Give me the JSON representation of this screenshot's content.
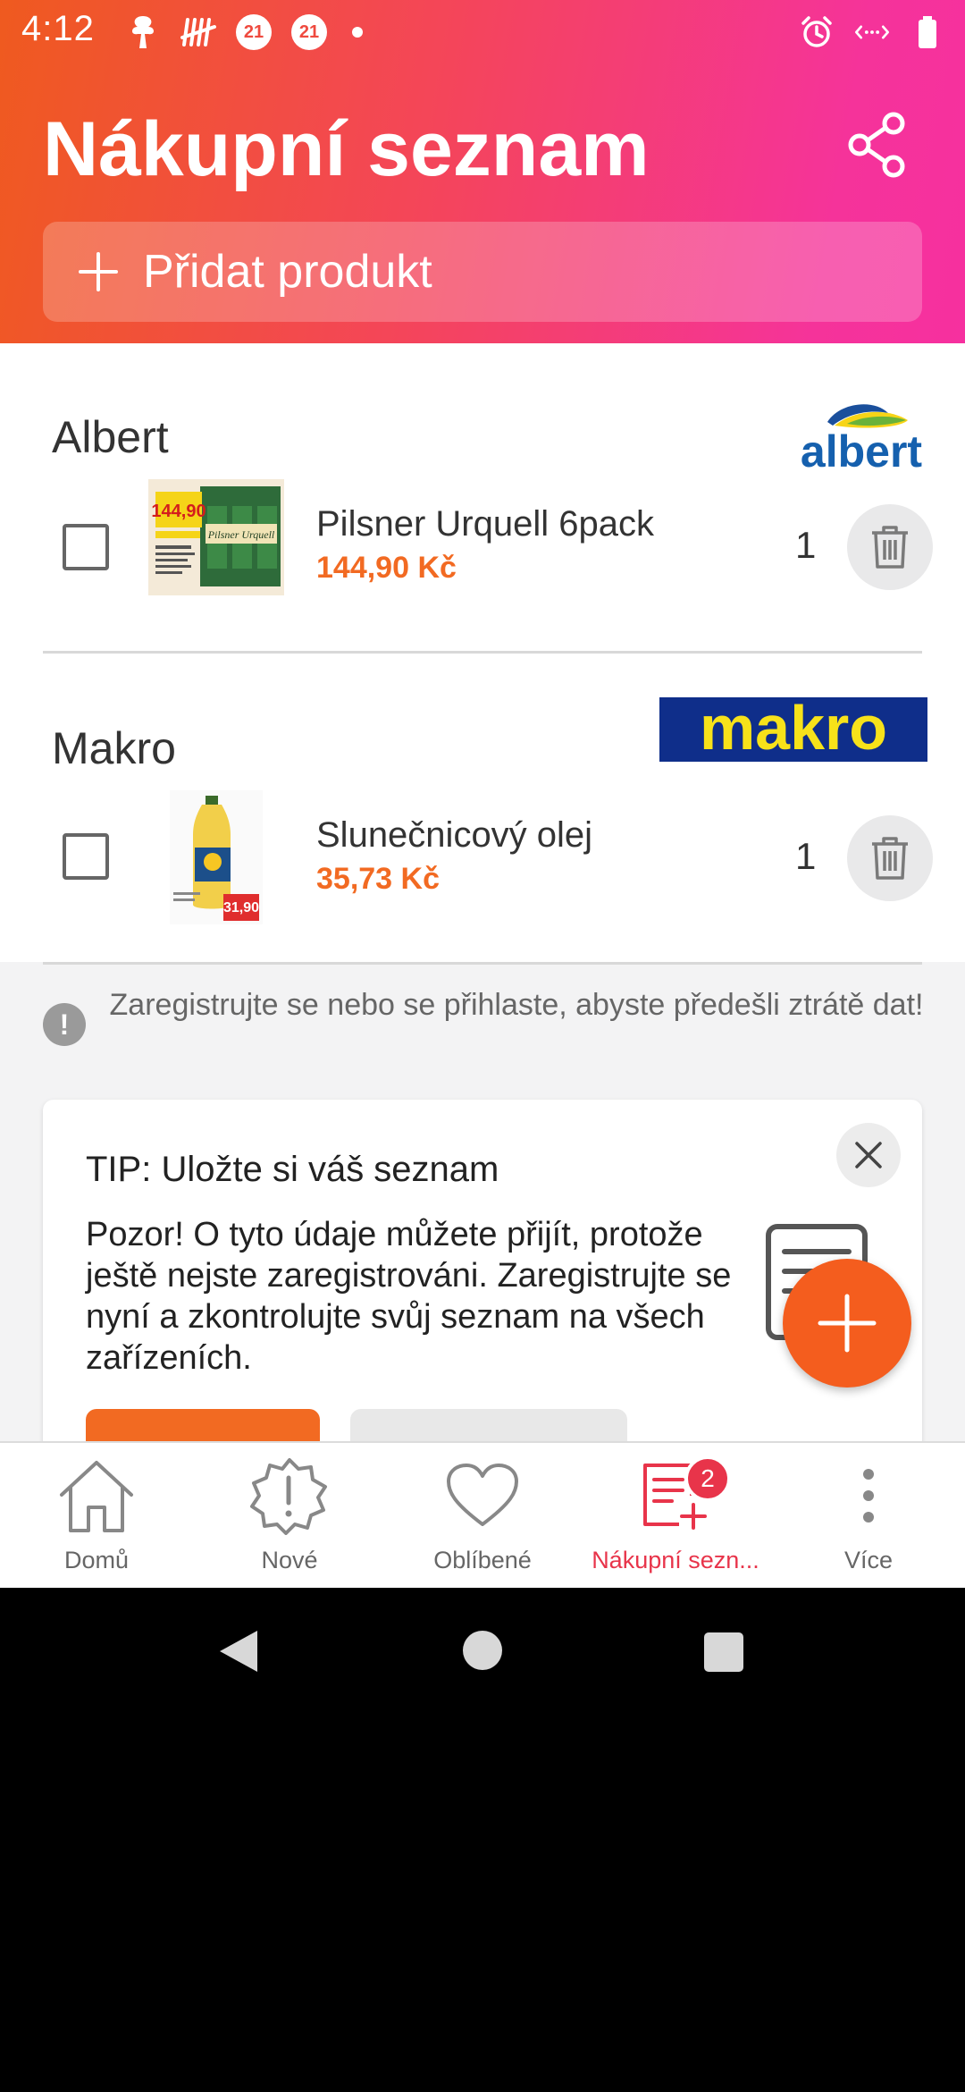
{
  "status_bar": {
    "time": "4:12",
    "badge1": "21",
    "badge2": "21"
  },
  "header": {
    "title": "Nákupní seznam",
    "add_product_label": "Přidat produkt"
  },
  "stores": [
    {
      "name": "Albert",
      "logo_text": "albert",
      "items": [
        {
          "name": "Pilsner Urquell 6pack",
          "price": "144,90 Kč",
          "qty": "1",
          "thumb_price": "144,90"
        }
      ]
    },
    {
      "name": "Makro",
      "logo_text": "makro",
      "items": [
        {
          "name": "Slunečnicový olej",
          "price": "35,73 Kč",
          "qty": "1",
          "thumb_price": "31,90"
        }
      ]
    }
  ],
  "notice": {
    "text": "Zaregistrujte se nebo se přihlaste, abyste předešli ztrátě dat!"
  },
  "tip": {
    "title": "TIP: Uložte si váš seznam",
    "body": "Pozor! O tyto údaje můžete přijít, protože ještě nejste zaregistrováni. Zaregistrujte se nyní a zkontrolujte svůj seznam na všech zařízeních."
  },
  "bottom_nav": {
    "items": [
      {
        "label": "Domů",
        "icon": "home-icon"
      },
      {
        "label": "Nové",
        "icon": "new-badge-icon"
      },
      {
        "label": "Oblíbené",
        "icon": "heart-icon"
      },
      {
        "label": "Nákupní sezn...",
        "icon": "shopping-list-icon",
        "badge": "2",
        "active": true
      },
      {
        "label": "Více",
        "icon": "more-vertical-icon"
      }
    ]
  },
  "colors": {
    "accent_orange": "#f26a22",
    "active_red": "#e8344a",
    "header_gradient_start": "#ef5a1f",
    "header_gradient_end": "#f6309f"
  }
}
